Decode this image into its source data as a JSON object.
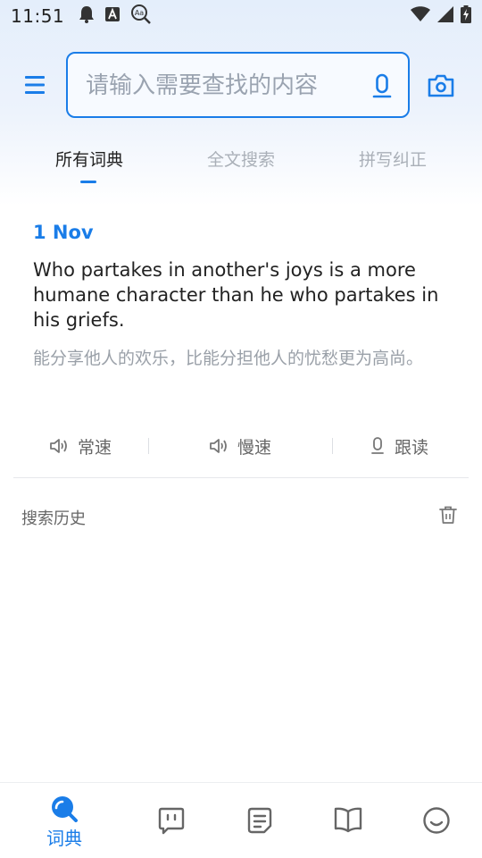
{
  "status_bar": {
    "time": "11:51",
    "left_icons": [
      "notification-bell-icon",
      "font-a-icon",
      "dictionary-search-icon"
    ],
    "right_icons": [
      "wifi-icon",
      "cell-signal-icon",
      "battery-charging-icon"
    ]
  },
  "search": {
    "placeholder": "请输入需要查找的内容",
    "value": ""
  },
  "tabs": [
    {
      "label": "所有词典",
      "active": true
    },
    {
      "label": "全文搜索",
      "active": false
    },
    {
      "label": "拼写纠正",
      "active": false
    }
  ],
  "daily_sentence": {
    "date": "1 Nov",
    "english": "Who partakes in another's joys is a more humane character than he who partakes in his griefs.",
    "chinese": "能分享他人的欢乐，比能分担他人的忧愁更为高尚。"
  },
  "audio_controls": {
    "normal_label": "常速",
    "slow_label": "慢速",
    "follow_label": "跟读"
  },
  "history": {
    "title": "搜索历史"
  },
  "bottom_nav": {
    "dictionary_label": "词典",
    "items": [
      "search-icon",
      "chat-icon",
      "notes-icon",
      "book-icon",
      "smile-icon"
    ]
  },
  "colors": {
    "accent": "#1a7de8",
    "muted_text": "#9aa0a8",
    "top_gradient": "#e4eefb"
  }
}
